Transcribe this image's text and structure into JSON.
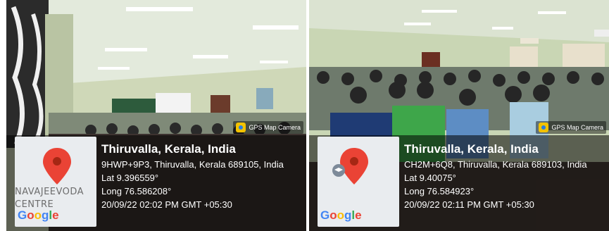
{
  "photos": [
    {
      "badge": "GPS Map Camera",
      "map_label": "NAVAJEEVODA\nCENTRE",
      "google": [
        "G",
        "o",
        "o",
        "g",
        "l",
        "e"
      ],
      "title": "Thiruvalla, Kerala, India",
      "address": "9HWP+9P3, Thiruvalla, Kerala 689105, India",
      "lat": "Lat 9.396559°",
      "long": "Long 76.586208°",
      "datetime": "20/09/22 02:02 PM GMT +05:30"
    },
    {
      "badge": "GPS Map Camera",
      "map_label": "",
      "google": [
        "G",
        "o",
        "o",
        "g",
        "l",
        "e"
      ],
      "title": "Thiruvalla, Kerala, India",
      "address": "CH2M+6Q8, Thiruvalla, Kerala 689103, India",
      "lat": "Lat 9.40075°",
      "long": "Long 76.584923°",
      "datetime": "20/09/22 02:11 PM GMT +05:30"
    }
  ],
  "colors": {
    "pin": "#ea4335",
    "overlay": "rgba(0,0,0,0.55)",
    "wall": "#cfd8b8",
    "ceiling": "#dfe6d4"
  }
}
